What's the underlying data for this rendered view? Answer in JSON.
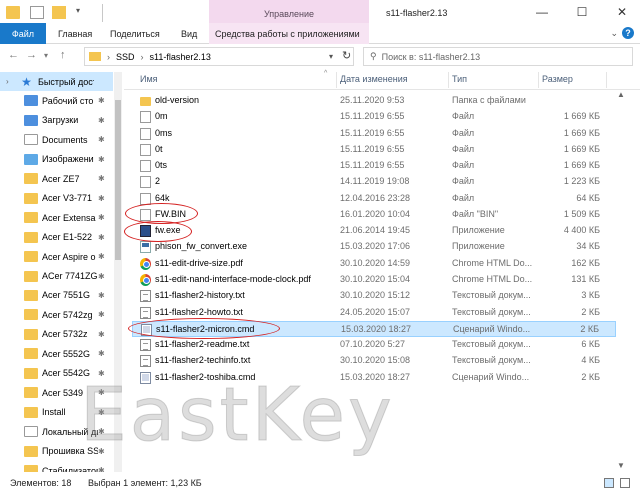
{
  "window": {
    "title": "s11-flasher2.13",
    "context_group": "Управление",
    "minimize": "—",
    "maximize": "☐",
    "close": "✕"
  },
  "ribbon": {
    "tabs": [
      "Файл",
      "Главная",
      "Поделиться",
      "Вид"
    ],
    "context_tab": "Средства работы с приложениями",
    "help": "?"
  },
  "address": {
    "segments": [
      "SSD",
      "s11-flasher2.13"
    ],
    "search_placeholder": "Поиск в: s11-flasher2.13"
  },
  "navigation": [
    {
      "label": "Быстрый доступ",
      "icon": "star-icon",
      "active": true,
      "pinned": false
    },
    {
      "label": "Рабочий сто",
      "icon": "folder-blue-icon",
      "pinned": true
    },
    {
      "label": "Загрузки",
      "icon": "download-folder-icon",
      "pinned": true
    },
    {
      "label": "Documents",
      "icon": "documents-icon",
      "pinned": true
    },
    {
      "label": "Изображени",
      "icon": "images-folder-icon",
      "pinned": true
    },
    {
      "label": "Acer ZE7",
      "icon": "folder-icon",
      "pinned": true
    },
    {
      "label": "Acer V3-771",
      "icon": "folder-icon",
      "pinned": true
    },
    {
      "label": "Acer Extensa",
      "icon": "folder-icon",
      "pinned": true
    },
    {
      "label": "Acer E1-522",
      "icon": "folder-icon",
      "pinned": true
    },
    {
      "label": "Acer Aspire o",
      "icon": "folder-icon",
      "pinned": true
    },
    {
      "label": "ACer 7741ZG",
      "icon": "folder-icon",
      "pinned": true
    },
    {
      "label": "Acer 7551G",
      "icon": "folder-icon",
      "pinned": true
    },
    {
      "label": "Acer 5742zg",
      "icon": "folder-icon",
      "pinned": true
    },
    {
      "label": "Acer 5732z",
      "icon": "folder-icon",
      "pinned": true
    },
    {
      "label": "Acer 5552G",
      "icon": "folder-icon",
      "pinned": true
    },
    {
      "label": "Acer 5542G",
      "icon": "folder-icon",
      "pinned": true
    },
    {
      "label": "Acer 5349",
      "icon": "folder-icon",
      "pinned": true
    },
    {
      "label": "Install",
      "icon": "folder-icon",
      "pinned": true
    },
    {
      "label": "Локальный дис",
      "icon": "drive-icon",
      "pinned": true
    },
    {
      "label": "Прошивка SSD",
      "icon": "folder-icon",
      "pinned": true
    },
    {
      "label": "Стабилизатор",
      "icon": "folder-icon",
      "pinned": true
    }
  ],
  "columns": [
    "Имя",
    "Дата изменения",
    "Тип",
    "Размер"
  ],
  "files": [
    {
      "name": "old-version",
      "date": "25.11.2020 9:53",
      "type": "Папка с файлами",
      "size": "",
      "icon": "folder"
    },
    {
      "name": "0m",
      "date": "15.11.2019 6:55",
      "type": "Файл",
      "size": "1 669 КБ",
      "icon": "file"
    },
    {
      "name": "0ms",
      "date": "15.11.2019 6:55",
      "type": "Файл",
      "size": "1 669 КБ",
      "icon": "file"
    },
    {
      "name": "0t",
      "date": "15.11.2019 6:55",
      "type": "Файл",
      "size": "1 669 КБ",
      "icon": "file"
    },
    {
      "name": "0ts",
      "date": "15.11.2019 6:55",
      "type": "Файл",
      "size": "1 669 КБ",
      "icon": "file"
    },
    {
      "name": "2",
      "date": "14.11.2019 19:08",
      "type": "Файл",
      "size": "1 223 КБ",
      "icon": "file"
    },
    {
      "name": "64k",
      "date": "12.04.2016 23:28",
      "type": "Файл",
      "size": "64 КБ",
      "icon": "file"
    },
    {
      "name": "FW.BIN",
      "date": "16.01.2020 10:04",
      "type": "Файл \"BIN\"",
      "size": "1 509 КБ",
      "icon": "file"
    },
    {
      "name": "fw.exe",
      "date": "21.06.2014 19:45",
      "type": "Приложение",
      "size": "4 400 КБ",
      "icon": "fw"
    },
    {
      "name": "phison_fw_convert.exe",
      "date": "15.03.2020 17:06",
      "type": "Приложение",
      "size": "34 КБ",
      "icon": "exe"
    },
    {
      "name": "s11-edit-drive-size.pdf",
      "date": "30.10.2020 14:59",
      "type": "Chrome HTML Do...",
      "size": "162 КБ",
      "icon": "chrome"
    },
    {
      "name": "s11-edit-nand-interface-mode-clock.pdf",
      "date": "30.10.2020 15:04",
      "type": "Chrome HTML Do...",
      "size": "131 КБ",
      "icon": "chrome"
    },
    {
      "name": "s11-flasher2-history.txt",
      "date": "30.10.2020 15:12",
      "type": "Текстовый докум...",
      "size": "3 КБ",
      "icon": "txt"
    },
    {
      "name": "s11-flasher2-howto.txt",
      "date": "24.05.2020 15:07",
      "type": "Текстовый докум...",
      "size": "2 КБ",
      "icon": "txt"
    },
    {
      "name": "s11-flasher2-micron.cmd",
      "date": "15.03.2020 18:27",
      "type": "Сценарий Windo...",
      "size": "2 КБ",
      "icon": "cmd",
      "selected": true
    },
    {
      "name": "s11-flasher2-readme.txt",
      "date": "07.10.2020 5:27",
      "type": "Текстовый докум...",
      "size": "6 КБ",
      "icon": "txt"
    },
    {
      "name": "s11-flasher2-techinfo.txt",
      "date": "30.10.2020 15:08",
      "type": "Текстовый докум...",
      "size": "4 КБ",
      "icon": "txt"
    },
    {
      "name": "s11-flasher2-toshiba.cmd",
      "date": "15.03.2020 18:27",
      "type": "Сценарий Windo...",
      "size": "2 КБ",
      "icon": "cmd"
    }
  ],
  "status": {
    "items": "Элементов: 18",
    "selection": "Выбран 1 элемент: 1,23 КБ"
  },
  "watermark": "EastKey",
  "colors": {
    "file_tab": "#1979ca",
    "context_tab": "#f3d9ee",
    "selection": "#cce8ff",
    "annotation": "#d42020"
  }
}
